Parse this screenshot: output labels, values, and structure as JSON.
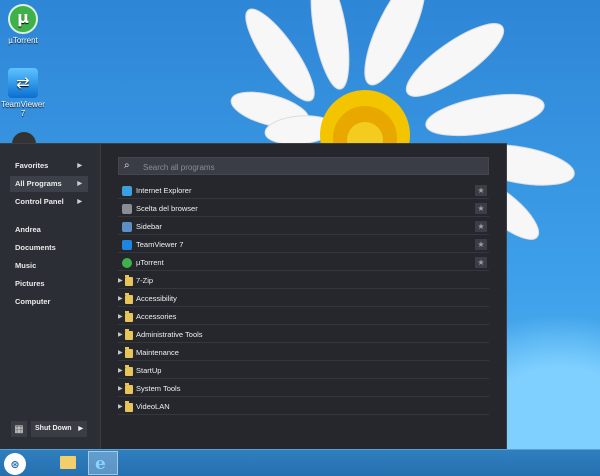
{
  "desktop": {
    "icons": [
      {
        "label": "µTorrent",
        "icon": "utorrent-icon"
      },
      {
        "label": "TeamViewer 7",
        "icon": "teamviewer-icon"
      }
    ]
  },
  "start_menu": {
    "left_items": [
      {
        "label": "Favorites",
        "has_arrow": true
      },
      {
        "label": "All Programs",
        "has_arrow": true,
        "active": true
      },
      {
        "label": "Control Panel",
        "has_arrow": true
      },
      {
        "label": "Andrea"
      },
      {
        "label": "Documents"
      },
      {
        "label": "Music"
      },
      {
        "label": "Pictures"
      },
      {
        "label": "Computer"
      }
    ],
    "arrow_glyph": "▶",
    "shutdown": {
      "label": "Shut Down",
      "arrow": "▶",
      "grid_glyph": "▦"
    },
    "search": {
      "placeholder": "Search all programs",
      "icon": "search-icon",
      "glyph": "⌕"
    },
    "programs": [
      {
        "label": "Internet Explorer",
        "icon": "internet-explorer-icon",
        "color": "#3aa0e0"
      },
      {
        "label": "Scelta del browser",
        "icon": "browser-choice-icon",
        "color": "#8a8d94"
      },
      {
        "label": "Sidebar",
        "icon": "sidebar-icon",
        "color": "#5c8fc8"
      },
      {
        "label": "TeamViewer 7",
        "icon": "teamviewer-icon",
        "color": "#1c86e0"
      },
      {
        "label": "µTorrent",
        "icon": "utorrent-icon",
        "color": "#3fb14a"
      }
    ],
    "star_glyph": "★",
    "folders": [
      {
        "label": "7-Zip"
      },
      {
        "label": "Accessibility"
      },
      {
        "label": "Accessories"
      },
      {
        "label": "Administrative Tools"
      },
      {
        "label": "Maintenance"
      },
      {
        "label": "StartUp"
      },
      {
        "label": "System Tools"
      },
      {
        "label": "VideoLAN"
      }
    ],
    "expand_glyph": "▶"
  },
  "taskbar": {
    "start_glyph": "⊛",
    "apps": [
      {
        "name": "file-explorer",
        "icon": "folder-icon",
        "active": false
      },
      {
        "name": "internet-explorer",
        "icon": "internet-explorer-icon",
        "active": true,
        "glyph": "e"
      }
    ]
  }
}
